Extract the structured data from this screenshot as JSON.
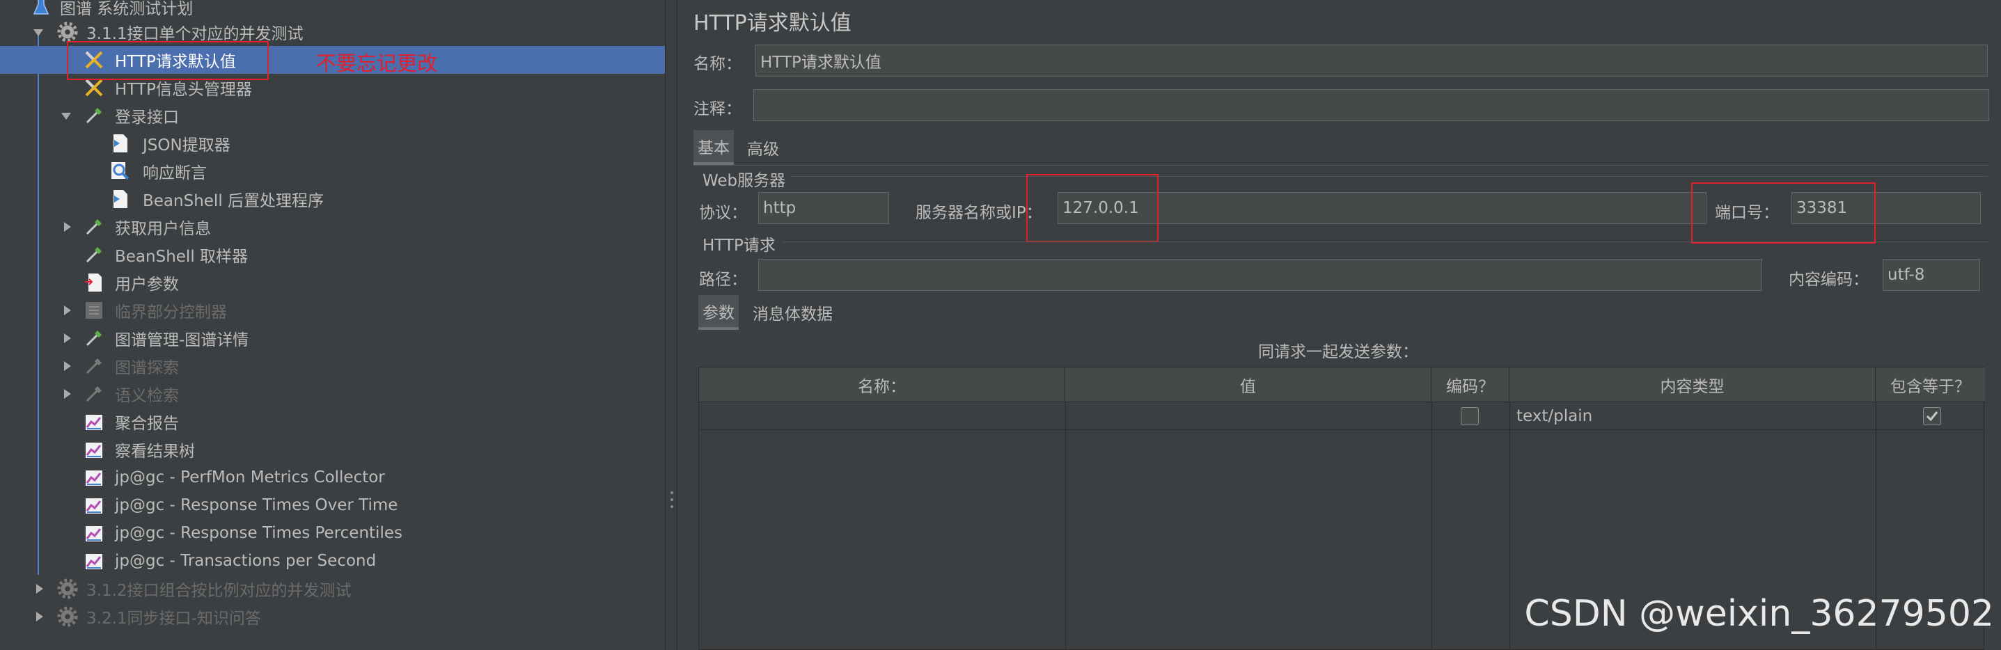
{
  "tree": {
    "items": [
      {
        "label": "图谱 系统测试计划",
        "icon": "flask-icon",
        "toggle": "none",
        "enabled": true
      },
      {
        "label": "3.1.1接口单个对应的并发测试",
        "icon": "gear-icon",
        "toggle": "open",
        "enabled": true
      },
      {
        "label": "HTTP请求默认值",
        "icon": "wrench-icon",
        "toggle": "none",
        "enabled": true,
        "selected": true
      },
      {
        "label": "HTTP信息头管理器",
        "icon": "wrench-icon",
        "toggle": "none",
        "enabled": true
      },
      {
        "label": "登录接口",
        "icon": "pipette-icon",
        "toggle": "open",
        "enabled": true
      },
      {
        "label": "JSON提取器",
        "icon": "document-icon",
        "toggle": "none",
        "enabled": true
      },
      {
        "label": "响应断言",
        "icon": "magnifier-icon",
        "toggle": "none",
        "enabled": true
      },
      {
        "label": "BeanShell 后置处理程序",
        "icon": "document-icon",
        "toggle": "none",
        "enabled": true
      },
      {
        "label": "获取用户信息",
        "icon": "pipette-icon",
        "toggle": "closed",
        "enabled": true
      },
      {
        "label": "BeanShell 取样器",
        "icon": "pipette-icon",
        "toggle": "none",
        "enabled": true
      },
      {
        "label": "用户参数",
        "icon": "document-icon",
        "toggle": "none",
        "enabled": true
      },
      {
        "label": "临界部分控制器",
        "icon": "controller-icon",
        "toggle": "closed",
        "enabled": false
      },
      {
        "label": "图谱管理-图谱详情",
        "icon": "pipette-icon",
        "toggle": "closed",
        "enabled": true
      },
      {
        "label": "图谱探索",
        "icon": "pipette-icon",
        "toggle": "closed",
        "enabled": false
      },
      {
        "label": "语义检索",
        "icon": "pipette-icon",
        "toggle": "closed",
        "enabled": false
      },
      {
        "label": "聚合报告",
        "icon": "graph-icon",
        "toggle": "none",
        "enabled": true
      },
      {
        "label": "察看结果树",
        "icon": "graph-icon",
        "toggle": "none",
        "enabled": true
      },
      {
        "label": "jp@gc - PerfMon Metrics Collector",
        "icon": "graph-icon",
        "toggle": "none",
        "enabled": true
      },
      {
        "label": "jp@gc - Response Times Over Time",
        "icon": "graph-icon",
        "toggle": "none",
        "enabled": true
      },
      {
        "label": "jp@gc - Response Times Percentiles",
        "icon": "graph-icon",
        "toggle": "none",
        "enabled": true
      },
      {
        "label": "jp@gc - Transactions per Second",
        "icon": "graph-icon",
        "toggle": "none",
        "enabled": true
      },
      {
        "label": "3.1.2接口组合按比例对应的并发测试",
        "icon": "gear-icon",
        "toggle": "closed",
        "enabled": false
      },
      {
        "label": "3.2.1同步接口-知识问答",
        "icon": "gear-icon",
        "toggle": "closed",
        "enabled": false
      }
    ],
    "annotation": "不要忘记更改"
  },
  "panel": {
    "title": "HTTP请求默认值",
    "name_label": "名称：",
    "name_value": "HTTP请求默认值",
    "comment_label": "注释：",
    "comment_value": "",
    "tabs": [
      "基本",
      "高级"
    ],
    "web_server_section": "Web服务器",
    "protocol_label": "协议：",
    "protocol_value": "http",
    "server_label": "服务器名称或IP：",
    "server_value": "127.0.0.1",
    "port_label": "端口号：",
    "port_value": "33381",
    "http_request_section": "HTTP请求",
    "path_label": "路径：",
    "path_value": "",
    "encoding_label": "内容编码：",
    "encoding_value": "utf-8",
    "sub_tabs": [
      "参数",
      "消息体数据"
    ],
    "params_caption": "同请求一起发送参数：",
    "table": {
      "headers": [
        "名称：",
        "值",
        "编码？",
        "内容类型",
        "包含等于？"
      ],
      "rows": [
        {
          "name": "",
          "value": "",
          "encode": false,
          "content_type": "text/plain",
          "include_equals": true
        }
      ]
    }
  },
  "watermark": "CSDN @weixin_36279502",
  "colors": {
    "selection": "#4b6eaf",
    "annotation_red": "#e0202b",
    "background": "#3c3f41"
  }
}
